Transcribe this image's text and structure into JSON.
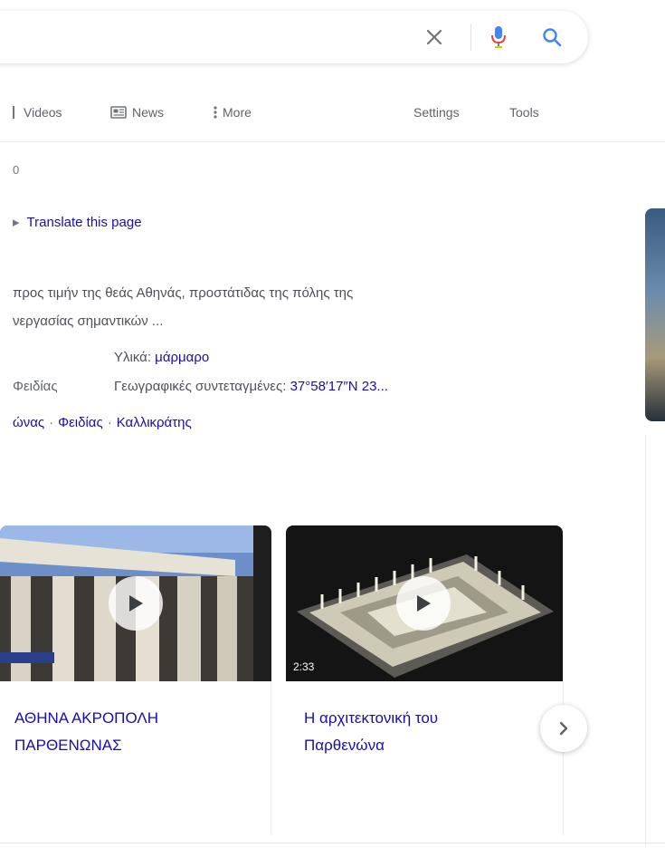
{
  "search": {
    "clear_icon": "close-icon",
    "mic_icon": "microphone-icon",
    "search_icon": "search-icon"
  },
  "tabs": {
    "videos": "Videos",
    "news": "News",
    "more": "More",
    "settings": "Settings",
    "tools": "Tools"
  },
  "result": {
    "stats_fragment": "0",
    "translate_link": "Translate this page",
    "snippet_line1": "προς τιμήν της θεάς Αθηνάς, προστάτιδας της πόλης της",
    "snippet_line2": "νεργασίας σημαντικών ...",
    "material_label": "Υλικά:",
    "material_value": "μάρμαρο",
    "architect_fragment": "Φειδίας",
    "coords_label": "Γεωγραφικές συντεταγμένες:",
    "coords_value": "37°58′17″N 23...",
    "related_links": [
      "ώνας",
      "Φειδίας",
      "Καλλικράτης"
    ]
  },
  "videos": [
    {
      "title_line1": "ΑΘΗΝΑ ΑΚΡΟΠΟΛΗ",
      "title_line2": "ΠΑΡΘΕΝΩΝΑΣ"
    },
    {
      "title_line1": "Η αρχιτεκτονική του",
      "title_line2": "Παρθενώνα"
    }
  ],
  "colors": {
    "link": "#1a0dab",
    "mic_blue": "#4285f4",
    "mic_red": "#ea4335",
    "text": "#4d5156"
  }
}
